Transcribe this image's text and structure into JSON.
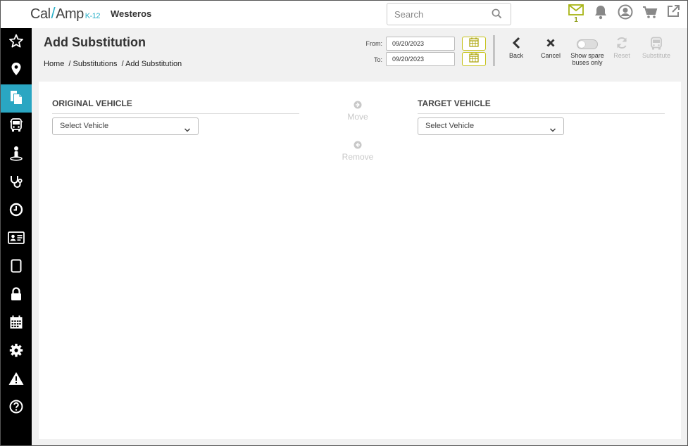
{
  "brand": {
    "name_left": "Cal",
    "name_right": "Amp",
    "suffix": "K-12"
  },
  "district": "Westeros",
  "search": {
    "placeholder": "Search",
    "value": ""
  },
  "top_icons": [
    {
      "name": "mail-icon",
      "badge": "1"
    },
    {
      "name": "bell-icon"
    },
    {
      "name": "user-circle-icon"
    },
    {
      "name": "cart-icon"
    },
    {
      "name": "external-link-icon"
    }
  ],
  "sidebar": {
    "items": [
      {
        "name": "star-icon",
        "active": false
      },
      {
        "name": "map-pin-icon",
        "active": false
      },
      {
        "name": "copy-icon",
        "active": true
      },
      {
        "name": "bus-icon",
        "active": false
      },
      {
        "name": "student-icon",
        "active": false
      },
      {
        "name": "stethoscope-icon",
        "active": false
      },
      {
        "name": "clock-icon",
        "active": false
      },
      {
        "name": "id-card-icon",
        "active": false
      },
      {
        "name": "tablet-icon",
        "active": false
      },
      {
        "name": "lock-icon",
        "active": false
      },
      {
        "name": "calendar-icon",
        "active": false
      },
      {
        "name": "gear-icon",
        "active": false
      },
      {
        "name": "warning-icon",
        "active": false
      },
      {
        "name": "help-icon",
        "active": false
      }
    ]
  },
  "header": {
    "title": "Add Substitution",
    "breadcrumb": [
      "Home",
      "/ Substitutions",
      "/ Add Substitution"
    ],
    "from_label": "From:",
    "from_value": "09/20/2023",
    "to_label": "To:",
    "to_value": "09/20/2023"
  },
  "actions": {
    "back": "Back",
    "cancel": "Cancel",
    "spare_line1": "Show spare",
    "spare_line2": "buses only",
    "spare_toggle_on": false,
    "reset": "Reset",
    "substitute": "Substitute"
  },
  "main": {
    "original_title": "ORIGINAL VEHICLE",
    "original_select": "Select Vehicle",
    "target_title": "TARGET VEHICLE",
    "target_select": "Select Vehicle",
    "move_label": "Move",
    "remove_label": "Remove"
  },
  "colors": {
    "accent_teal": "#2aa6c2",
    "accent_olive": "#c5c21a",
    "sidebar_bg": "#000000"
  }
}
